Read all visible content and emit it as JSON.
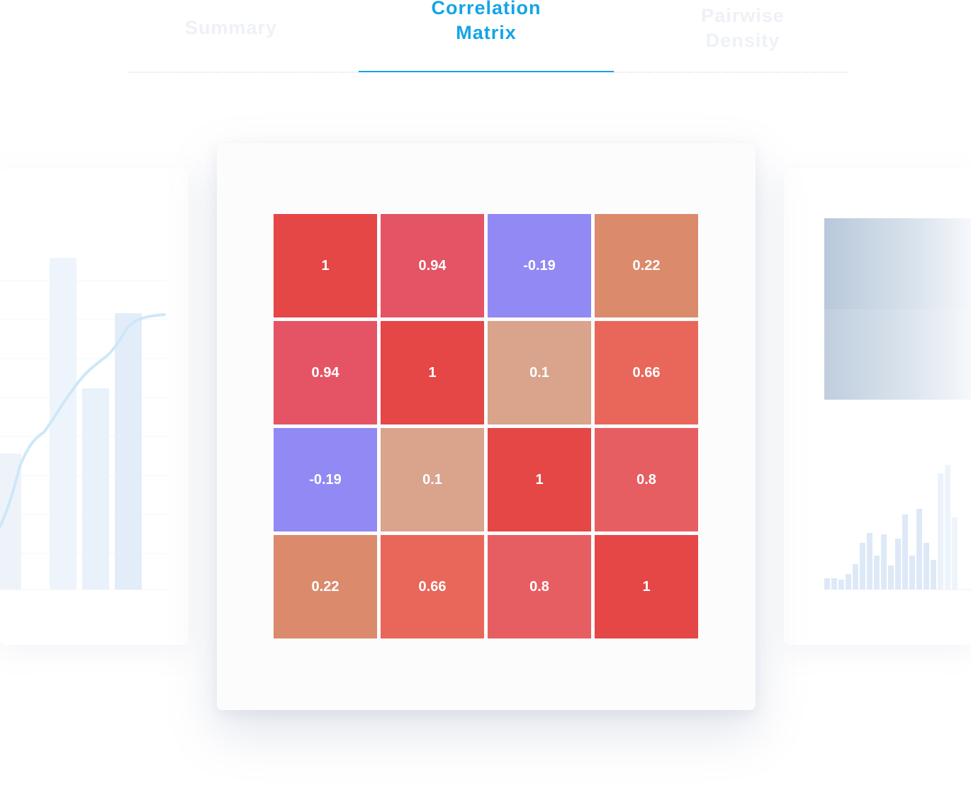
{
  "tabs": [
    {
      "id": "summary",
      "label": "Summary",
      "active": false
    },
    {
      "id": "correlation",
      "label": "Correlation\nMatrix",
      "active": true
    },
    {
      "id": "pairwise",
      "label": "Pairwise\nDensity",
      "active": false
    }
  ],
  "colors": {
    "accent": "#14a4e6",
    "strong_positive": "#e54646",
    "negative": "#9189f4",
    "neutral": "#d9a38c"
  },
  "chart_data": [
    {
      "type": "heatmap",
      "rows": 4,
      "cols": 4,
      "values": [
        [
          1,
          0.94,
          -0.19,
          0.22
        ],
        [
          0.94,
          1,
          0.1,
          0.66
        ],
        [
          -0.19,
          0.1,
          1,
          0.8
        ],
        [
          0.22,
          0.66,
          0.8,
          1
        ]
      ],
      "labels": [
        [
          "1",
          "0.94",
          "-0.19",
          "0.22"
        ],
        [
          "0.94",
          "1",
          "0.1",
          "0.66"
        ],
        [
          "-0.19",
          "0.1",
          "1",
          "0.8"
        ],
        [
          "0.22",
          "0.66",
          "0.8",
          "1"
        ]
      ]
    }
  ]
}
